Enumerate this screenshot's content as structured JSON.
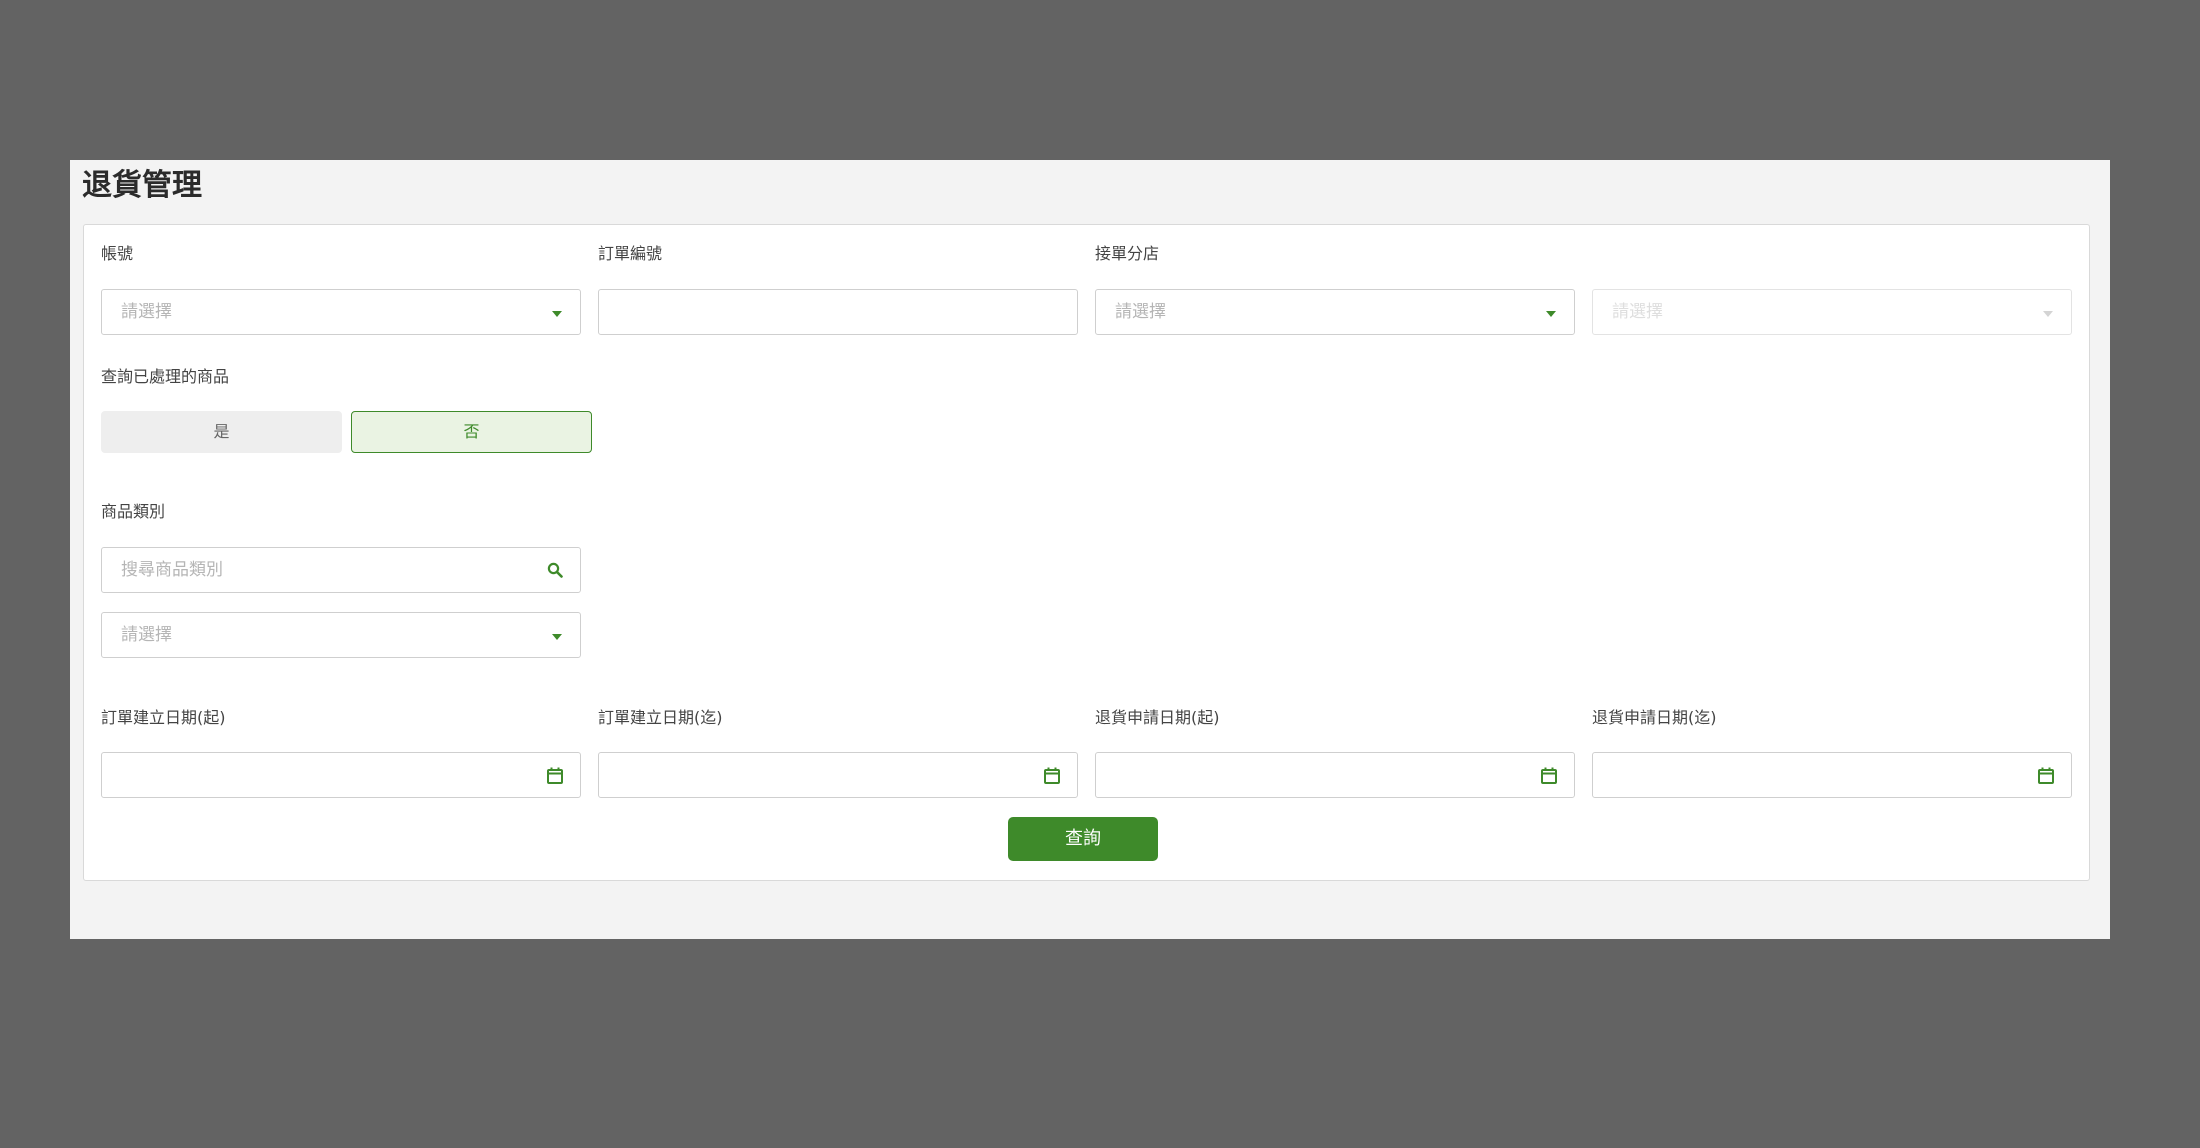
{
  "page": {
    "title": "退貨管理"
  },
  "filters": {
    "account": {
      "label": "帳號",
      "placeholder": "請選擇"
    },
    "order_no": {
      "label": "訂單編號",
      "value": ""
    },
    "branch": {
      "label": "接單分店",
      "placeholder": "請選擇"
    },
    "branch_sub": {
      "placeholder": "請選擇"
    },
    "processed": {
      "label": "查詢已處理的商品",
      "options": [
        "是",
        "否"
      ],
      "selected": "否"
    },
    "category": {
      "label": "商品類別",
      "search_placeholder": "搜尋商品類別",
      "select_placeholder": "請選擇"
    },
    "order_date_start": {
      "label": "訂單建立日期(起)",
      "value": ""
    },
    "order_date_end": {
      "label": "訂單建立日期(迄)",
      "value": ""
    },
    "return_date_start": {
      "label": "退貨申請日期(起)",
      "value": ""
    },
    "return_date_end": {
      "label": "退貨申請日期(迄)",
      "value": ""
    }
  },
  "actions": {
    "query_label": "查詢"
  },
  "colors": {
    "accent": "#3e8a2a",
    "accent_light": "#eaf3e3",
    "backdrop": "#636363",
    "panel": "#f3f3f3"
  },
  "icons": {
    "dropdown": "chevron-down-icon",
    "search": "search-icon",
    "date": "calendar-icon"
  }
}
